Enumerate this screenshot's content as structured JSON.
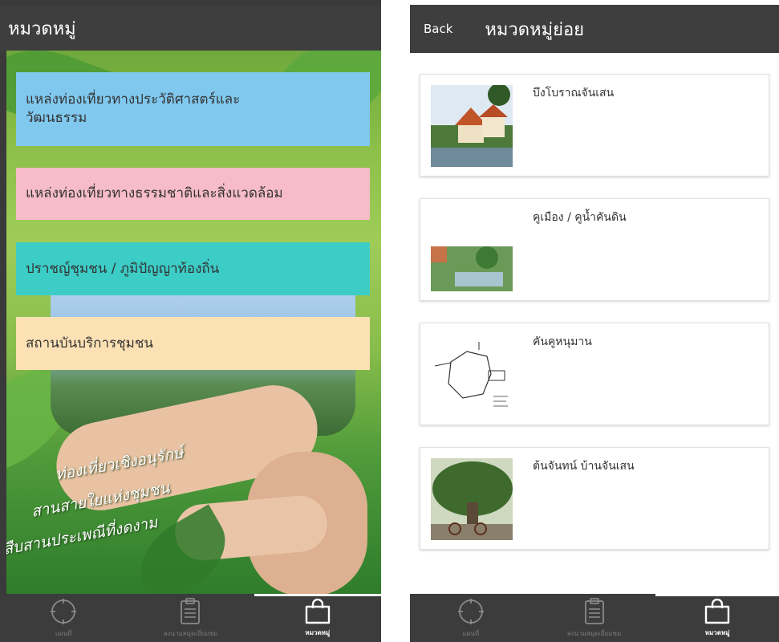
{
  "left_screen": {
    "title": "หมวดหมู่",
    "categories": [
      {
        "label": "แหล่งท่องเที่ยวทางประวัติศาสตร์และวัฒนธรรม",
        "color": "#80c8ee"
      },
      {
        "label": "แหล่งท่องเที่ยวทางธรรมชาติและสิ่งแวดล้อม",
        "color": "#f6bcc8"
      },
      {
        "label": "ปราชญ์ชุมชน / ภูมิปัญญาท้องถิ่น",
        "color": "#3ccdc7"
      },
      {
        "label": "สถานบันบริการชุมชน",
        "color": "#fce1b4"
      }
    ],
    "poster_slogan": [
      "ท่องเที่ยวเชิงอนุรักษ์",
      "สานสายใยแห่งชุมชน",
      "สืบสานประเพณีที่งดงาม"
    ]
  },
  "right_screen": {
    "back_label": "Back",
    "title": "หมวดหมู่ย่อย",
    "items": [
      {
        "title": "บึงโบราณจันเสน",
        "thumb_icon": "temple-lake-photo"
      },
      {
        "title": "คูเมือง / คูน้ำคันดิน",
        "thumb_icon": "moat-photo"
      },
      {
        "title": "คันคูหนุมาน",
        "thumb_icon": "map-sketch"
      },
      {
        "title": "ต้นจันทน์ บ้านจันเสน",
        "thumb_icon": "tree-photo"
      }
    ]
  },
  "bottom_nav": {
    "items": [
      {
        "label": "แผนที่",
        "icon": "compass-icon",
        "active": false
      },
      {
        "label": "ลงนามสมุดเยี่ยมชม",
        "icon": "clipboard-icon",
        "active": false
      },
      {
        "label": "หมวดหมู่",
        "icon": "bag-icon",
        "active": true
      }
    ]
  },
  "colors": {
    "appbar": "#3e3e3e",
    "nav": "#3c3c3c",
    "nav_active": "#ffffff",
    "nav_inactive": "#7a7a7a"
  }
}
